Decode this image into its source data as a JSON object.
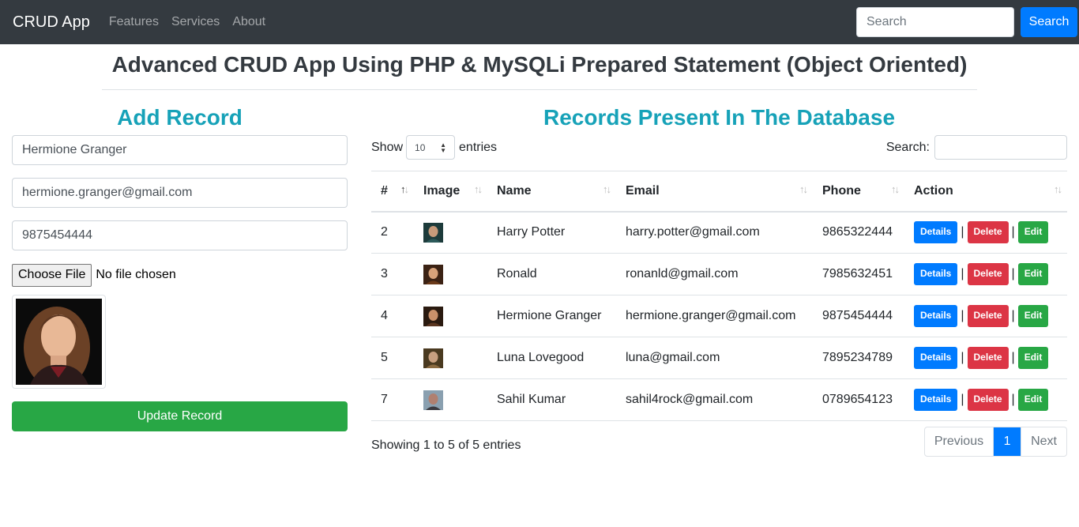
{
  "navbar": {
    "brand": "CRUD App",
    "links": [
      "Features",
      "Services",
      "About"
    ],
    "search_placeholder": "Search",
    "search_button": "Search"
  },
  "page_title": "Advanced CRUD App Using PHP & MySQLi Prepared Statement (Object Oriented)",
  "form": {
    "heading": "Add Record",
    "name_value": "Hermione Granger",
    "email_value": "hermione.granger@gmail.com",
    "phone_value": "9875454444",
    "file_button": "Choose File",
    "file_status": "No file chosen",
    "submit_label": "Update Record"
  },
  "records": {
    "heading": "Records Present In The Database",
    "show_label": "Show",
    "entries_value": "10",
    "entries_label": "entries",
    "search_label": "Search:",
    "columns": [
      "#",
      "Image",
      "Name",
      "Email",
      "Phone",
      "Action"
    ],
    "rows": [
      {
        "id": "2",
        "name": "Harry Potter",
        "email": "harry.potter@gmail.com",
        "phone": "9865322444"
      },
      {
        "id": "3",
        "name": "Ronald",
        "email": "ronanld@gmail.com",
        "phone": "7985632451"
      },
      {
        "id": "4",
        "name": "Hermione Granger",
        "email": "hermione.granger@gmail.com",
        "phone": "9875454444"
      },
      {
        "id": "5",
        "name": "Luna Lovegood",
        "email": "luna@gmail.com",
        "phone": "7895234789"
      },
      {
        "id": "7",
        "name": "Sahil Kumar",
        "email": "sahil4rock@gmail.com",
        "phone": "0789654123"
      }
    ],
    "action_labels": {
      "details": "Details",
      "delete": "Delete",
      "edit": "Edit",
      "separator": "|"
    },
    "info": "Showing 1 to 5 of 5 entries",
    "pagination": {
      "previous": "Previous",
      "current": "1",
      "next": "Next"
    }
  },
  "colors": {
    "navbar_bg": "#343a40",
    "primary": "#007bff",
    "danger": "#dc3545",
    "success": "#28a745",
    "info": "#17a2b8"
  }
}
